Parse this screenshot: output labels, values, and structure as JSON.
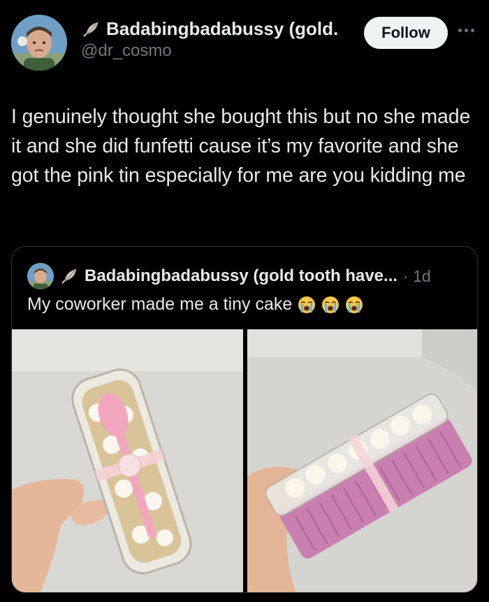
{
  "author": {
    "display_name": "Badabingbadabussy (gold...",
    "handle": "@dr_cosmo",
    "follow_label": "Follow"
  },
  "tweet": {
    "text": "I genuinely thought she bought this but no she made it and she did funfetti cause it’s my favorite and she got the pink tin especially for me are you kidding me"
  },
  "quoted": {
    "display_name": "Badabingbadabussy (gold tooth have...",
    "time": "· 1d",
    "text": "My coworker made me a tiny cake",
    "emojis": [
      "loudly-crying-face",
      "loudly-crying-face",
      "loudly-crying-face"
    ],
    "photos": [
      "cake-top-view-photo",
      "cake-side-view-photo"
    ]
  },
  "colors": {
    "background": "#000000",
    "text": "#e7e9ea",
    "secondary": "#71767b",
    "border": "#2f3336",
    "follow_bg": "#eff3f4"
  }
}
